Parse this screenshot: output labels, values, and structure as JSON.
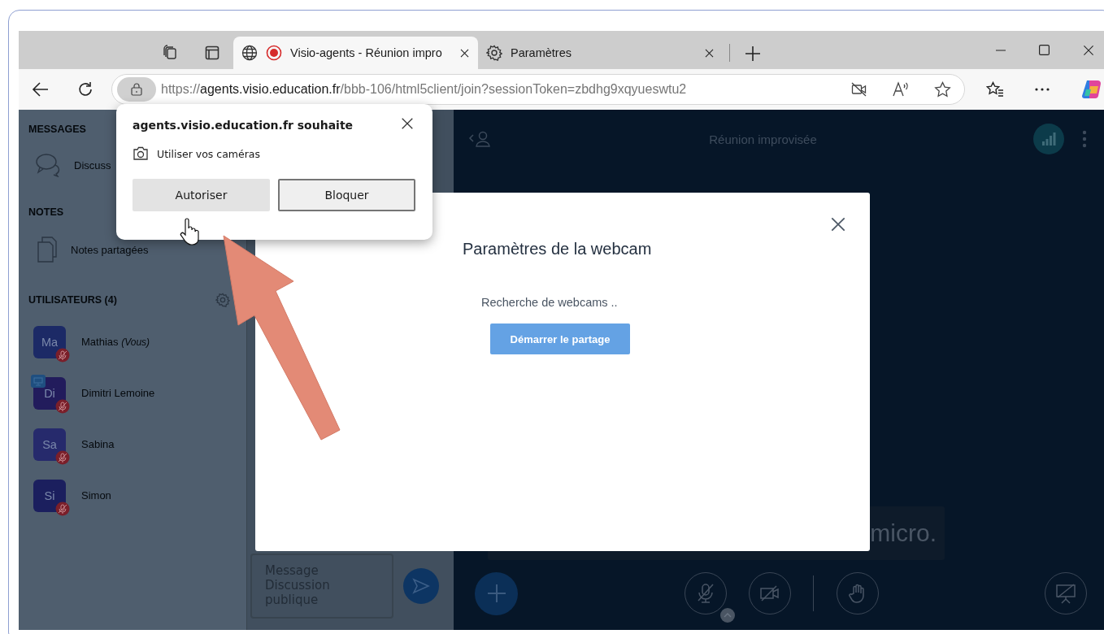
{
  "browser": {
    "tabs": [
      {
        "title": "Visio-agents - Réunion impro",
        "selected": true,
        "recording": true
      },
      {
        "title": "Paramètres",
        "selected": false,
        "recording": false
      }
    ],
    "address": [
      "https://",
      "agents.visio.education.fr",
      "/bbb-106/html5client/join?sessionToken=zbdhg9xqyueswtu2"
    ]
  },
  "permission_popup": {
    "title": "agents.visio.education.fr souhaite",
    "permission": "Utiliser vos caméras",
    "buttons": [
      {
        "label": "Autoriser",
        "hovered": true
      },
      {
        "label": "Bloquer",
        "hovered": false
      }
    ]
  },
  "sidebar": {
    "messages_heading": "MESSAGES",
    "chat_item": "Discuss",
    "notes_heading": "NOTES",
    "notes_item": "Notes partagées",
    "users_heading": "UTILISATEURS (4)"
  },
  "users": [
    {
      "initials": "Ma",
      "name": "Mathias",
      "suffix": "(Vous)",
      "color": "#1c2a66",
      "presenter": false,
      "muted": true
    },
    {
      "initials": "Di",
      "name": "Dimitri Lemoine",
      "color": "#221c5c",
      "presenter": true,
      "muted": true
    },
    {
      "initials": "Sa",
      "name": "Sabina",
      "color": "#262a6c",
      "presenter": false,
      "muted": true
    },
    {
      "initials": "Si",
      "name": "Simon",
      "color": "#1b1f5e",
      "presenter": false,
      "muted": true
    }
  ],
  "chat": {
    "placeholder": "Message Discussion publique"
  },
  "meeting": {
    "title": "Réunion improvisée",
    "caption": "micro."
  },
  "webcam_modal": {
    "title": "Paramètres de la webcam",
    "status": "Recherche de webcams ..",
    "button": "Démarrer le partage"
  }
}
